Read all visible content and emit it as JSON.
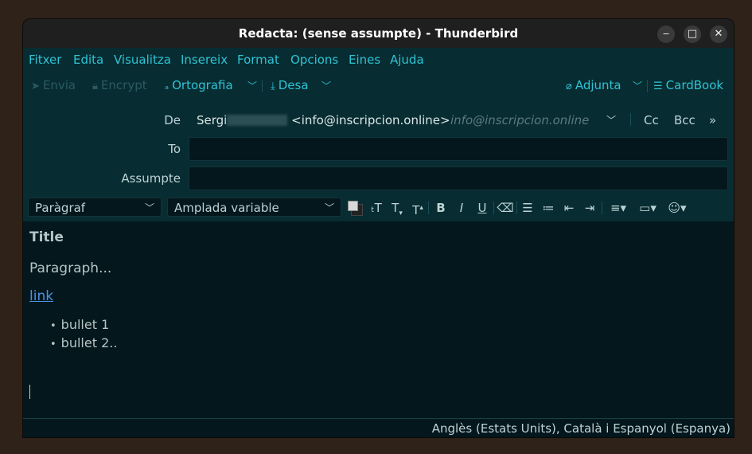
{
  "window": {
    "title": "Redacta: (sense assumpte) - Thunderbird",
    "minimize": "‒",
    "maximize": "□",
    "close": "✕"
  },
  "menubar": {
    "items": [
      "Fitxer",
      "Edita",
      "Visualitza",
      "Insereix",
      "Format",
      "Opcions",
      "Eines",
      "Ajuda"
    ]
  },
  "toolbar": {
    "send": "Envia",
    "encrypt": "Encrypt",
    "spelling": "Ortografia",
    "save": "Desa",
    "attach": "Adjunta",
    "cardbook": "CardBook"
  },
  "header": {
    "from_label": "De",
    "from_name": "Sergi",
    "from_name_tail": "<info@inscripcion.online>",
    "from_identity": "info@inscripcion.online",
    "cc": "Cc",
    "bcc": "Bcc",
    "more": "»",
    "to_label": "To",
    "to_value": "",
    "subject_label": "Assumpte",
    "subject_value": ""
  },
  "formatbar": {
    "paragraph_style": "Paràgraf",
    "font": "Amplada variable",
    "buttons": {
      "smaller": "T",
      "larger": "T",
      "bold": "B",
      "italic": "I",
      "underline": "U"
    }
  },
  "body": {
    "title": "Title",
    "paragraph": "Paragraph...",
    "link": "link",
    "bullets": [
      "bullet 1",
      "bullet 2.."
    ]
  },
  "statusbar": {
    "spellcheck_languages": "Anglès (Estats Units), Català i Espanyol (Espanya)"
  },
  "colors": {
    "accent": "#2fc3d4",
    "link": "#4b90e6",
    "background": "#03171c"
  }
}
